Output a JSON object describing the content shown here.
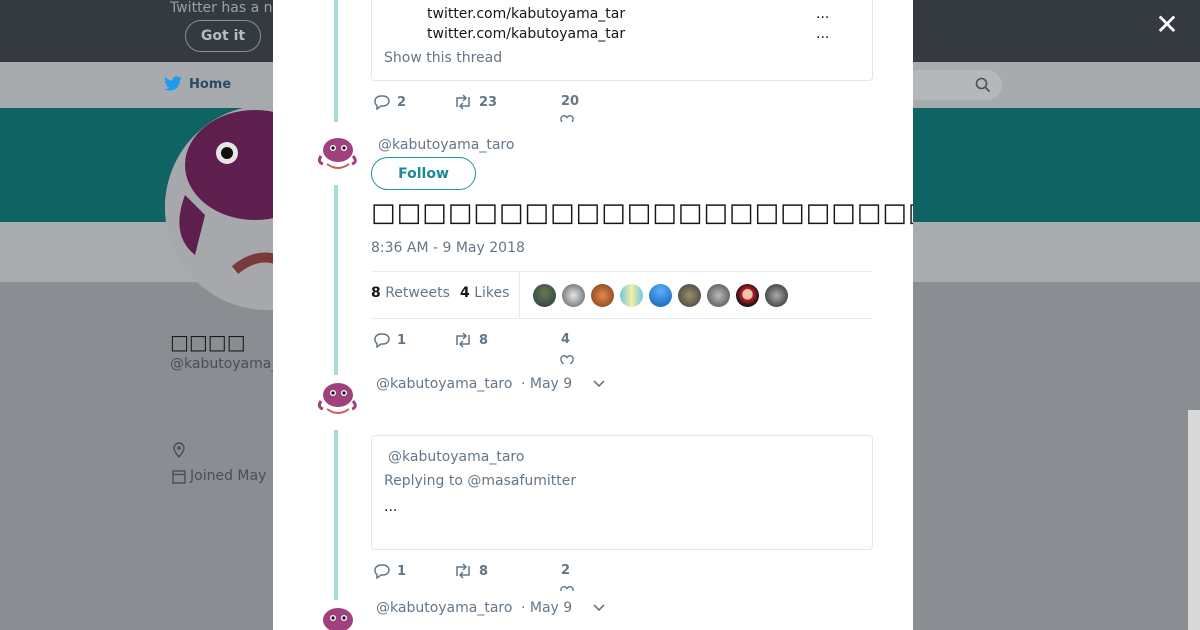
{
  "background": {
    "banner_text": "Twitter has a n",
    "got_it_label": "Got it",
    "nav_home_label": "Home",
    "profile_name": "□□□□",
    "profile_handle": "@kabutoyama_",
    "joined_text": "Joined May"
  },
  "modal": {
    "close_icon": "close-icon",
    "thread_card_top": {
      "links": [
        "twitter.com/kabutoyama_tar",
        "twitter.com/kabutoyama_tar"
      ],
      "ellipsis": "...",
      "show_thread_label": "Show this thread"
    },
    "tweet1_actions": {
      "replies": "2",
      "retweets": "23",
      "likes": "20"
    },
    "main_tweet": {
      "handle": "@kabutoyama_taro",
      "follow_label": "Follow",
      "text": "□□□□□□□□□□□□□□□□□□□□□□□□□□□□□□□□□□□□□□□□□□□□□□□□□",
      "timestamp": "8:36 AM - 9 May 2018",
      "retweets_count": "8",
      "retweets_label": "Retweets",
      "likes_count": "4",
      "likes_label": "Likes",
      "actions": {
        "replies": "1",
        "retweets": "8",
        "likes": "4"
      }
    },
    "reply_tweet": {
      "handle": "@kabutoyama_taro",
      "date": "· May 9",
      "quoted_handle": "@kabutoyama_taro",
      "replying_to": "Replying to @masafumitter",
      "quoted_text": "...",
      "actions": {
        "replies": "1",
        "retweets": "8",
        "likes": "2"
      }
    },
    "next_tweet": {
      "handle": "@kabutoyama_taro",
      "date": "· May 9"
    }
  },
  "colors": {
    "accent": "#1b8a95",
    "thread_line": "#a8dad8",
    "muted": "#657786"
  }
}
